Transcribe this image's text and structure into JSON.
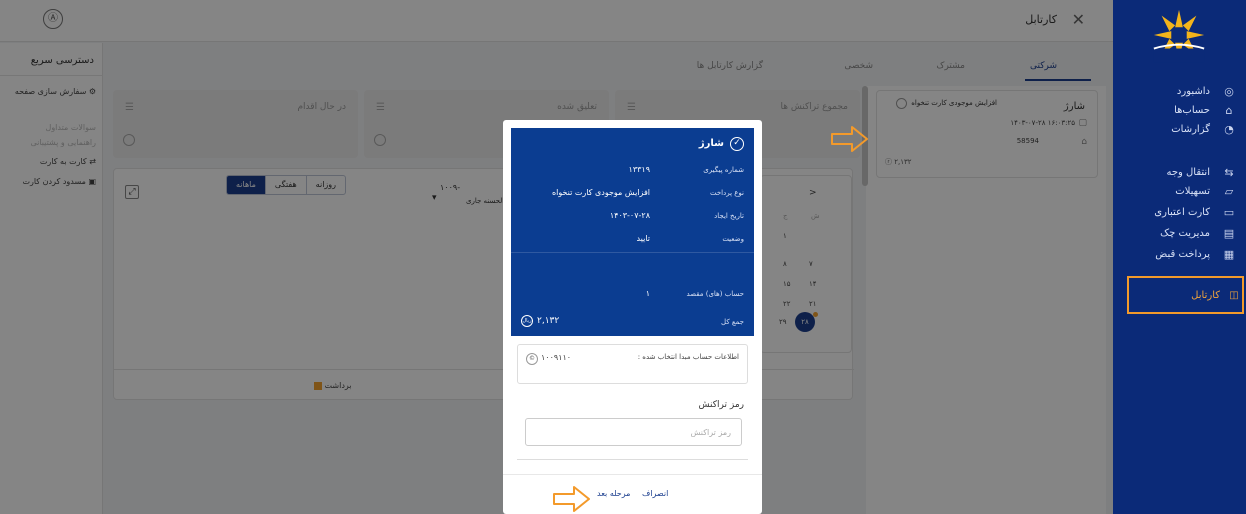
{
  "topbar": {
    "title": "کارتابل",
    "close_glyph": "✕",
    "avatar_glyph": "Ⓐ"
  },
  "quick_access": {
    "title": "دسترسی سریع",
    "items": [
      {
        "label": "سفارش سازی صفحه",
        "muted": false
      },
      {
        "label": "سوالات متداول",
        "muted": true
      },
      {
        "label": "راهنمایی و پشتیبانی",
        "muted": true
      },
      {
        "label": "کارت به کارت",
        "muted": false
      },
      {
        "label": "مسدود کردن کارت",
        "muted": false
      }
    ]
  },
  "tabs": [
    {
      "label": "شرکتی",
      "active": true
    },
    {
      "label": "مشترک",
      "active": false
    },
    {
      "label": "شخصی",
      "active": false
    },
    {
      "label": "گزارش کارتابل ها",
      "active": false
    }
  ],
  "sidebar": {
    "items": [
      {
        "label": "داشبورد",
        "icon": "dashboard-icon",
        "glyph": "◎"
      },
      {
        "label": "حساب‌ها",
        "icon": "bank-icon",
        "glyph": "⌂"
      },
      {
        "label": "گزارشات",
        "icon": "report-icon",
        "glyph": "◔"
      },
      {
        "label": "انتقال وجه",
        "icon": "transfer-icon",
        "glyph": "⇆"
      },
      {
        "label": "تسهیلات",
        "icon": "loan-icon",
        "glyph": "▱"
      },
      {
        "label": "کارت اعتباری",
        "icon": "credit-card-icon",
        "glyph": "▭"
      },
      {
        "label": "مدیریت چک",
        "icon": "check-icon",
        "glyph": "▤"
      },
      {
        "label": "پرداخت قبض",
        "icon": "bill-icon",
        "glyph": "▦"
      }
    ],
    "active_item": {
      "label": "کارتابل",
      "icon": "cartable-icon",
      "glyph": "◫"
    }
  },
  "stats": [
    {
      "label": "مجموع تراکنش ها"
    },
    {
      "label": "تعلیق شده"
    },
    {
      "label": "در حال اقدام"
    }
  ],
  "transaction_card": {
    "title": "شارژ",
    "subtitle": "افزایش موجودی کارت تنخواه",
    "datetime": "۱۴۰۳-۰۷-۲۸ ۱۶:۰۳:۲۵",
    "number": "58594",
    "amount": "۲,۱۳۲"
  },
  "chart_panel": {
    "segments": [
      "روزانه",
      "هفتگی",
      "ماهانه"
    ],
    "selected_segment": "ماهانه",
    "account_short": "۱۰۰۹-",
    "account_label": "ن الحسنه جاری",
    "legend": "برداشت",
    "legend_color": "#f3a12c"
  },
  "calendar": {
    "nav": ">",
    "weekday": "ش",
    "weekday2": "ج",
    "days": [
      "۱",
      "۷",
      "۸",
      "۱۴",
      "۱۵",
      "۲۱",
      "۲۲",
      "۲۸",
      "۲۹"
    ],
    "today": "۲۸"
  },
  "modal": {
    "title": "شارژ",
    "fields": [
      {
        "key": "شماره پیگیری",
        "value": "۱۳۳۱۹"
      },
      {
        "key": "نوع پرداخت",
        "value": "افزایش موجودی کارت تنخواه"
      },
      {
        "key": "تاریخ ایجاد",
        "value": "۱۴۰۳-۰۷-۲۸"
      },
      {
        "key": "وضعیت",
        "value": "تایید"
      }
    ],
    "dest_key": "حساب (های) مقصد",
    "dest_value": "۱",
    "total_key": "جمع کل",
    "total_value": "۲,۱۳۲",
    "currency_glyph": "ریال",
    "source_label": "اطلاعات حساب مبدا انتخاب شده :",
    "source_value": "۱۰۰۹۱۱۰",
    "pin_label": "رمز تراکنش",
    "pin_placeholder": "رمز تراکنش",
    "cancel_label": "انصراف",
    "next_label": "مرحله بعد"
  },
  "colors": {
    "navy": "#0b2a78",
    "modal_header": "#0b3d91",
    "accent": "#f39a2b",
    "primary": "#1c3f8f"
  }
}
